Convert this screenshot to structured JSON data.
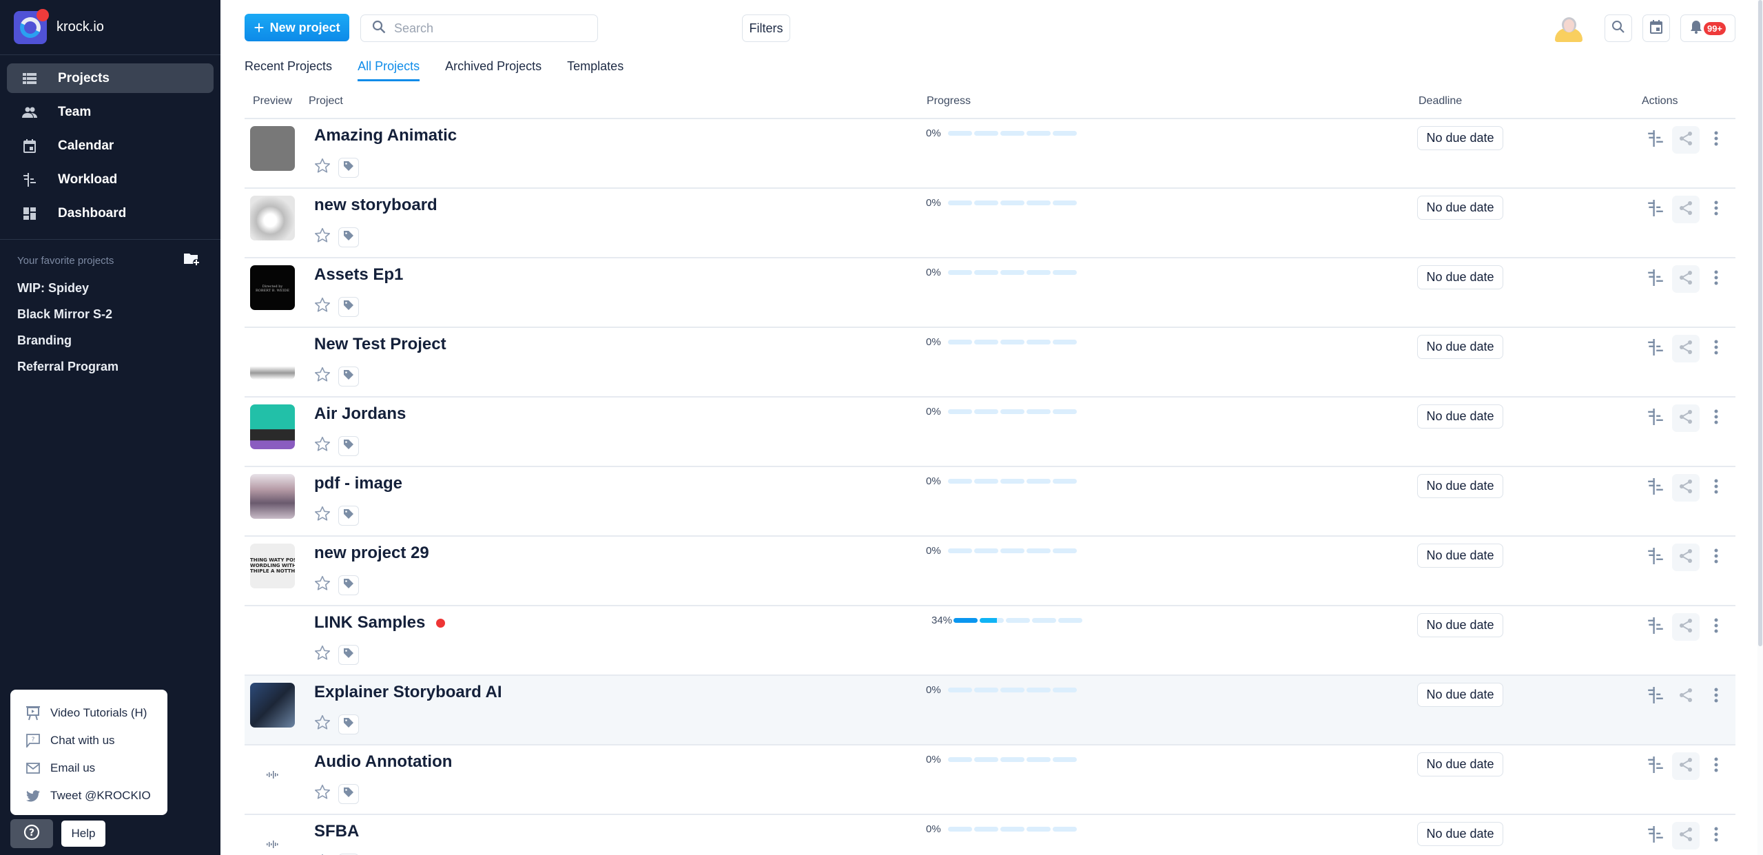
{
  "brand": {
    "name": "krock.io",
    "colors": {
      "sidebar_bg": "#121a2c",
      "accent": "#0f8ce9",
      "alert": "#ee3a3a"
    }
  },
  "sidebar": {
    "nav": [
      {
        "label": "Projects",
        "icon": "list-icon",
        "active": true
      },
      {
        "label": "Team",
        "icon": "people-icon"
      },
      {
        "label": "Calendar",
        "icon": "calendar-icon"
      },
      {
        "label": "Workload",
        "icon": "workload-icon"
      },
      {
        "label": "Dashboard",
        "icon": "dashboard-icon"
      }
    ],
    "favorites_title": "Your favorite projects",
    "favorites": [
      "WIP: Spidey",
      "Black Mirror S-2",
      "Branding",
      "Referral Program"
    ]
  },
  "help": {
    "menu": [
      {
        "label": "Video Tutorials (H)",
        "icon": "presentation-icon"
      },
      {
        "label": "Chat with us",
        "icon": "chat-question-icon"
      },
      {
        "label": "Email us",
        "icon": "mail-icon"
      },
      {
        "label": "Tweet @KROCKIO",
        "icon": "twitter-icon"
      }
    ],
    "button_label": "Help"
  },
  "toolbar": {
    "new_project": "New project",
    "search_placeholder": "Search",
    "search_value": "",
    "filters": "Filters",
    "notifications_badge": "99+"
  },
  "tabs": [
    {
      "label": "Recent Projects"
    },
    {
      "label": "All Projects",
      "active": true
    },
    {
      "label": "Archived Projects"
    },
    {
      "label": "Templates"
    }
  ],
  "table": {
    "headers": {
      "preview": "Preview",
      "project": "Project",
      "progress": "Progress",
      "deadline": "Deadline",
      "actions": "Actions"
    },
    "rows": [
      {
        "name": "Amazing Animatic",
        "progress": 0,
        "progress_label": "0%",
        "deadline": "No due date",
        "thumb": "gray"
      },
      {
        "name": "new storyboard",
        "progress": 0,
        "progress_label": "0%",
        "deadline": "No due date",
        "thumb": "sketch"
      },
      {
        "name": "Assets Ep1",
        "progress": 0,
        "progress_label": "0%",
        "deadline": "No due date",
        "thumb": "black"
      },
      {
        "name": "New Test Project",
        "progress": 0,
        "progress_label": "0%",
        "deadline": "No due date",
        "thumb": "handshake"
      },
      {
        "name": "Air Jordans",
        "progress": 0,
        "progress_label": "0%",
        "deadline": "No due date",
        "thumb": "cartoon"
      },
      {
        "name": "pdf - image",
        "progress": 0,
        "progress_label": "0%",
        "deadline": "No due date",
        "thumb": "street"
      },
      {
        "name": "new project 29",
        "progress": 0,
        "progress_label": "0%",
        "deadline": "No due date",
        "thumb": "text"
      },
      {
        "name": "LINK Samples",
        "progress": 34,
        "progress_label": "34%",
        "deadline": "No due date",
        "thumb": "none",
        "alert": true
      },
      {
        "name": "Explainer Storyboard AI",
        "progress": 0,
        "progress_label": "0%",
        "deadline": "No due date",
        "thumb": "hospital",
        "hover": true
      },
      {
        "name": "Audio Annotation",
        "progress": 0,
        "progress_label": "0%",
        "deadline": "No due date",
        "thumb": "audio"
      },
      {
        "name": "SFBA",
        "progress": 0,
        "progress_label": "0%",
        "deadline": "No due date",
        "thumb": "audio"
      }
    ]
  }
}
